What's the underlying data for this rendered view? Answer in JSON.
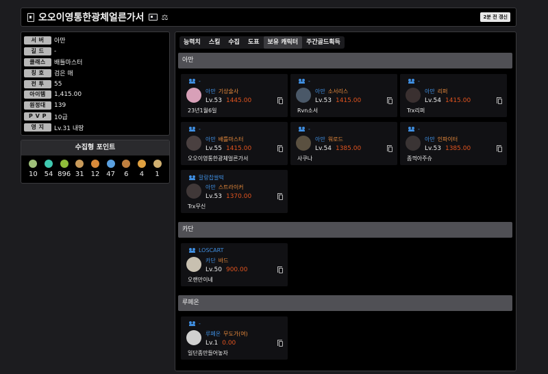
{
  "header": {
    "title": "오오이영통한광체얼른가서",
    "update_label": "2분 전 갱신"
  },
  "info": [
    {
      "label": "서 버",
      "value": "아만"
    },
    {
      "label": "길 드",
      "value": "-"
    },
    {
      "label": "클래스",
      "value": "배틀마스터"
    },
    {
      "label": "칭 호",
      "value": "검은 매"
    },
    {
      "label": "전 투",
      "value": "55"
    },
    {
      "label": "아이템",
      "value": "1,415.00"
    },
    {
      "label": "원정대",
      "value": "139"
    },
    {
      "label": "P V P",
      "value": "10급"
    },
    {
      "label": "영 지",
      "value": "Lv.31 내땅"
    }
  ],
  "collect": {
    "title": "수집형 포인트",
    "items": [
      {
        "icon": "mokoko-seed-icon",
        "count": "10",
        "color": "#9fc07a"
      },
      {
        "icon": "island-heart-icon",
        "count": "54",
        "color": "#3fc9b0"
      },
      {
        "icon": "world-tree-leaf-icon",
        "count": "896",
        "color": "#8fbd3a"
      },
      {
        "icon": "great-art-icon",
        "count": "31",
        "color": "#c89a5a"
      },
      {
        "icon": "orpheus-star-icon",
        "count": "12",
        "color": "#d88a3a"
      },
      {
        "icon": "giant-heart-icon",
        "count": "47",
        "color": "#5aa0e0"
      },
      {
        "icon": "ignea-token-icon",
        "count": "6",
        "color": "#c08040"
      },
      {
        "icon": "sea-bounty-icon",
        "count": "4",
        "color": "#e0a040"
      },
      {
        "icon": "masterpiece-icon",
        "count": "1",
        "color": "#d0b070"
      }
    ]
  },
  "tabs": [
    "능력치",
    "스킬",
    "수집",
    "도표",
    "보유 캐릭터",
    "주간골드획득"
  ],
  "active_tab": "보유 캐릭터",
  "sections": [
    {
      "name": "아만",
      "characters": [
        {
          "guild": "-",
          "server": "아만",
          "class": "기상술사",
          "level": "Lv.53",
          "ilvl": "1445.00",
          "name": "23년1월6일",
          "avatar_color": "#d8a0b8"
        },
        {
          "guild": "-",
          "server": "아만",
          "class": "소서리스",
          "level": "Lv.53",
          "ilvl": "1415.00",
          "name": "Rvn소서",
          "avatar_color": "#4a5868"
        },
        {
          "guild": "-",
          "server": "아만",
          "class": "리퍼",
          "level": "Lv.54",
          "ilvl": "1415.00",
          "name": "Trx리퍼",
          "avatar_color": "#3a3030"
        },
        {
          "guild": "-",
          "server": "아만",
          "class": "배틀마스터",
          "level": "Lv.55",
          "ilvl": "1415.00",
          "name": "오오이영통한광체얼른가서",
          "avatar_color": "#4a4040"
        },
        {
          "guild": "-",
          "server": "아만",
          "class": "워로드",
          "level": "Lv.54",
          "ilvl": "1385.00",
          "name": "사쿠나",
          "avatar_color": "#5a5040"
        },
        {
          "guild": "-",
          "server": "아만",
          "class": "인파이터",
          "level": "Lv.53",
          "ilvl": "1385.00",
          "name": "좀꺽아주슈",
          "avatar_color": "#3a3434"
        },
        {
          "guild": "말랑찹쌀떡",
          "server": "아만",
          "class": "스트라이커",
          "level": "Lv.53",
          "ilvl": "1370.00",
          "name": "Trx무신",
          "avatar_color": "#403838"
        }
      ]
    },
    {
      "name": "카단",
      "characters": [
        {
          "guild": "LOSCART",
          "server": "카단",
          "class": "바드",
          "level": "Lv.50",
          "ilvl": "900.00",
          "name": "오랜만이네",
          "avatar_color": "#c8c0b0"
        }
      ]
    },
    {
      "name": "루페온",
      "characters": [
        {
          "guild": "-",
          "server": "루페온",
          "class": "무도가(여)",
          "level": "Lv.1",
          "ilvl": "0.00",
          "name": "일단좀만들어놓자",
          "avatar_color": "#d0d0d0"
        }
      ]
    }
  ]
}
